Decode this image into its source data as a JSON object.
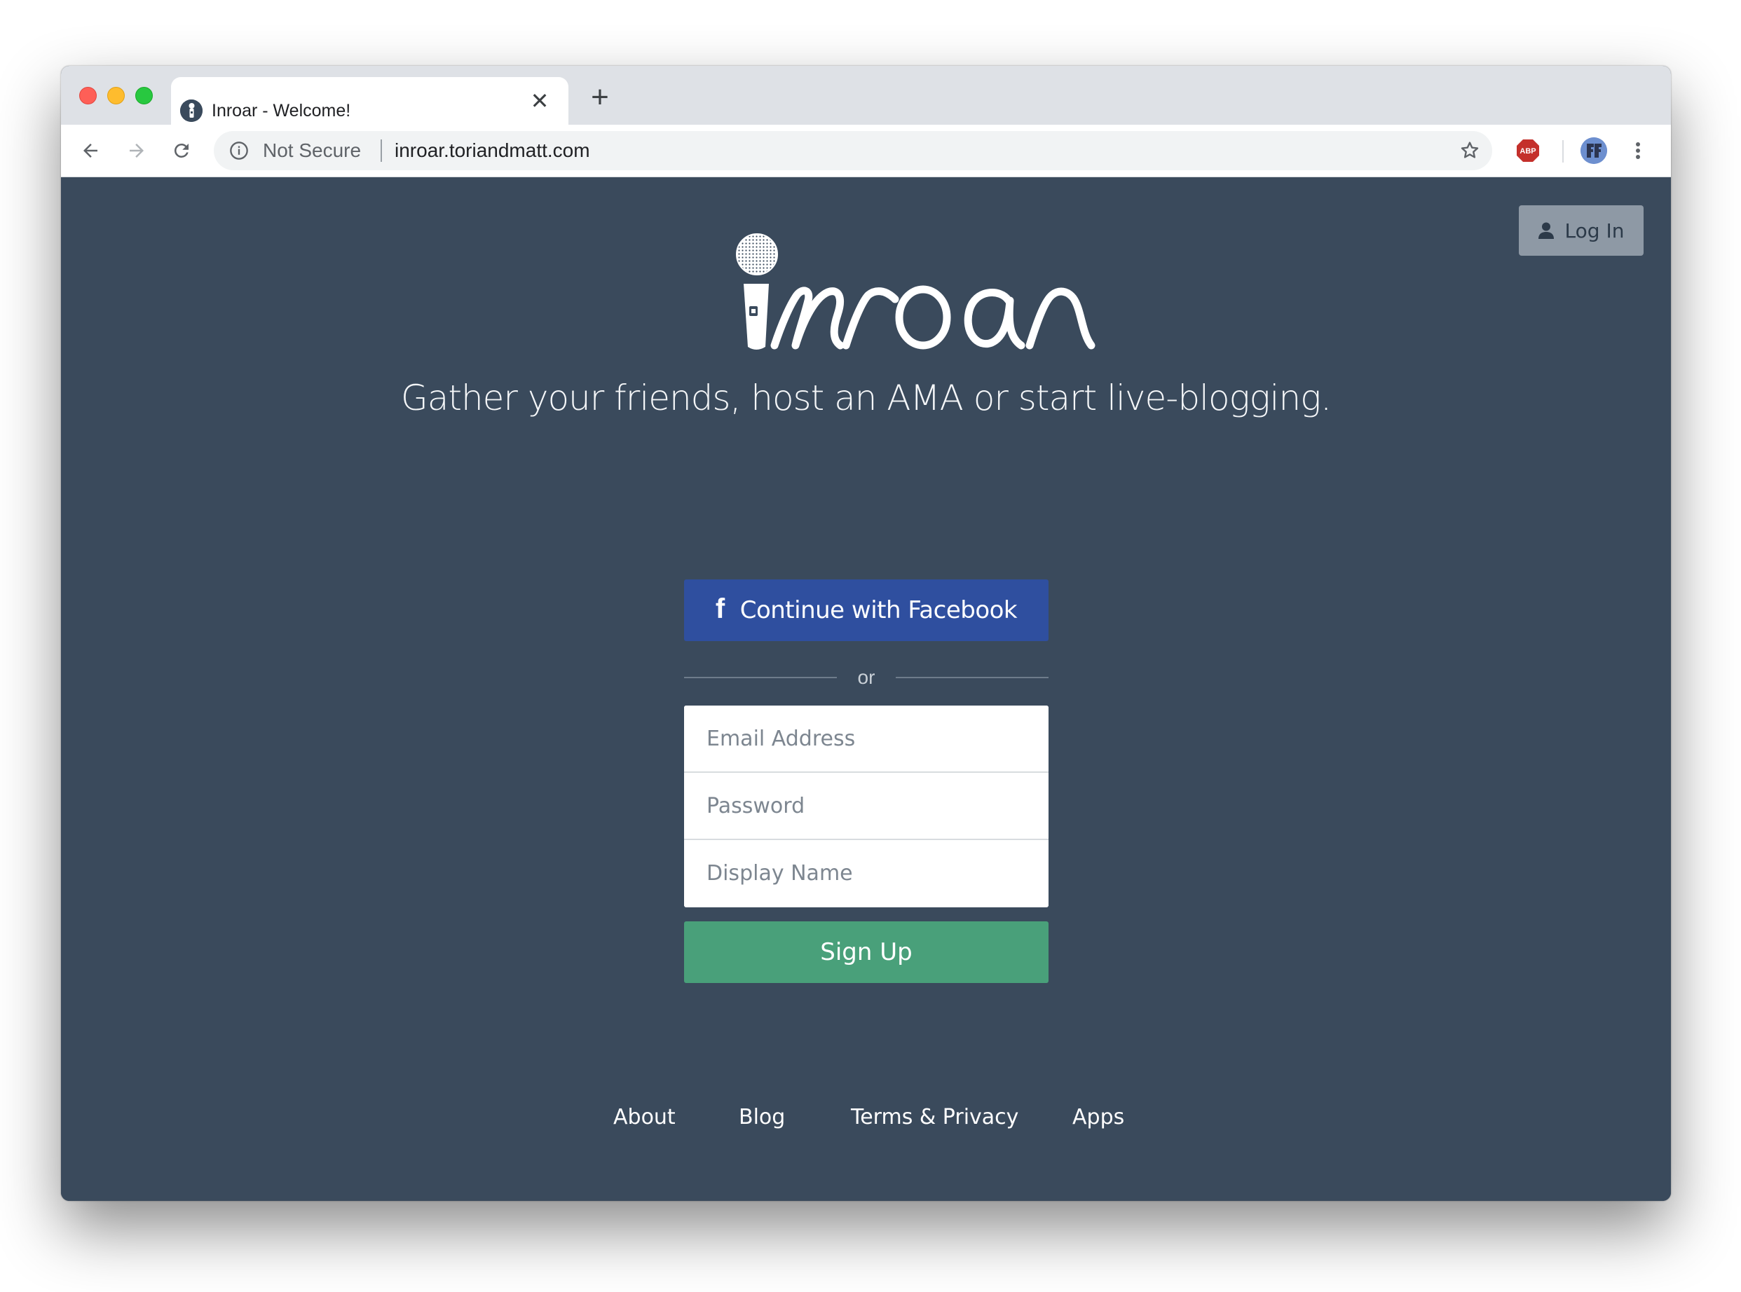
{
  "browser": {
    "tab": {
      "title": "Inroar - Welcome!",
      "close_glyph": "✕"
    },
    "new_tab_glyph": "+",
    "address_bar": {
      "security_label": "Not Secure",
      "url": "inroar.toriandmatt.com"
    },
    "extensions": [
      "abp-icon",
      "profile-avatar"
    ]
  },
  "header": {
    "login_label": "Log In"
  },
  "hero": {
    "logo_text": "inroar",
    "tagline": "Gather your friends, host an AMA or start live-blogging."
  },
  "signup": {
    "facebook_label": "Continue with Facebook",
    "facebook_icon": "f",
    "divider_text": "or",
    "email_placeholder": "Email Address",
    "password_placeholder": "Password",
    "display_name_placeholder": "Display Name",
    "submit_label": "Sign Up"
  },
  "footer": {
    "links": [
      "About",
      "Blog",
      "Terms & Privacy",
      "Apps"
    ]
  },
  "colors": {
    "page_background": "#3a4a5c",
    "facebook_blue": "#2f4f9f",
    "signup_green": "#49a07a",
    "login_gray": "#8e99a5"
  }
}
